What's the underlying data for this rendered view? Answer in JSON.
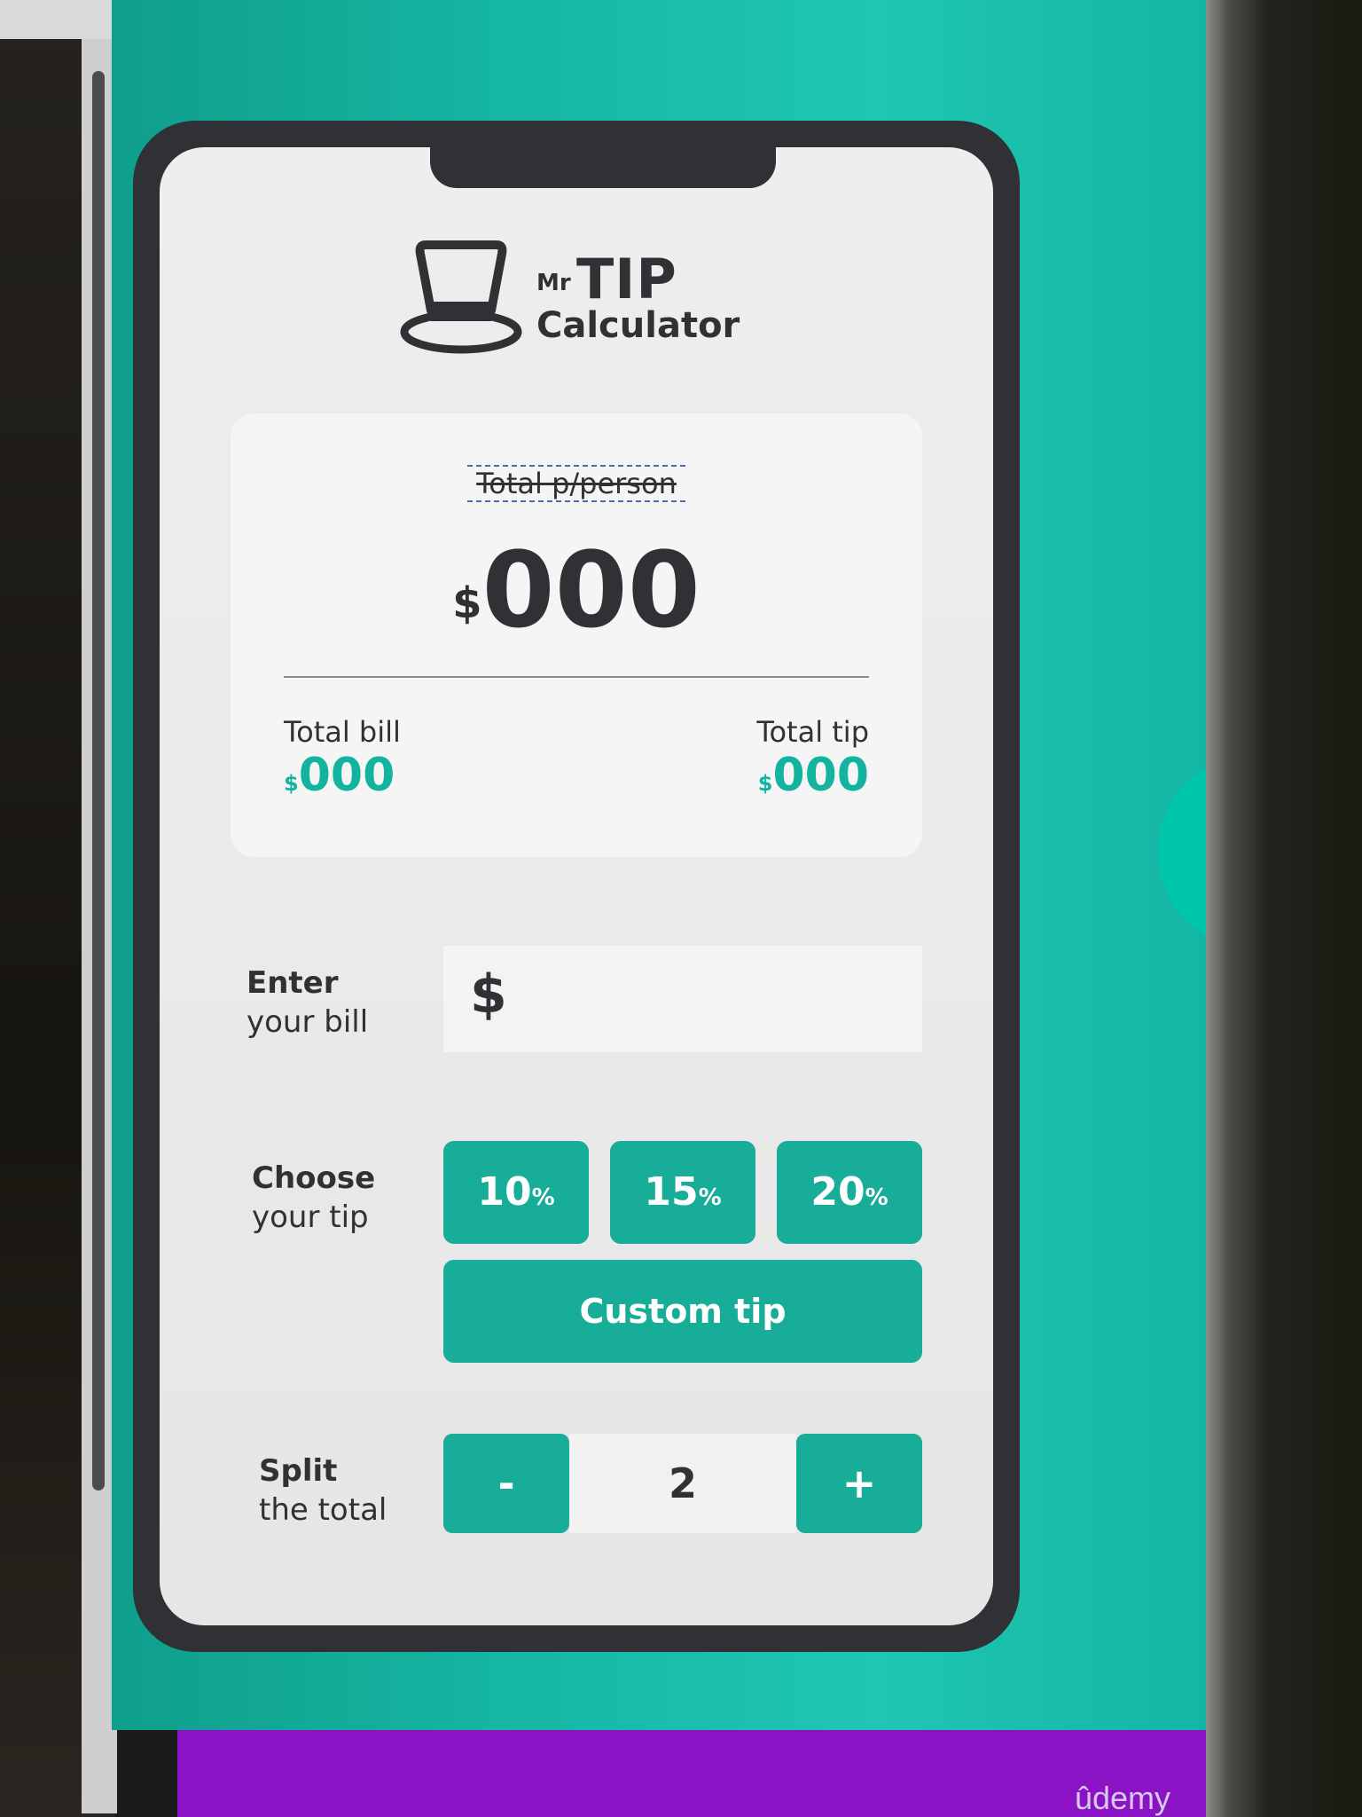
{
  "app": {
    "logo_prefix": "Mr",
    "logo_title": "TIP",
    "logo_subtitle": "Calculator"
  },
  "summary": {
    "per_person_label": "Total p/person",
    "per_person_currency": "$",
    "per_person_value": "000",
    "total_bill_label": "Total bill",
    "total_bill_currency": "$",
    "total_bill_value": "000",
    "total_tip_label": "Total tip",
    "total_tip_currency": "$",
    "total_tip_value": "000"
  },
  "bill": {
    "label_bold": "Enter",
    "label_rest": "your bill",
    "currency": "$"
  },
  "tip": {
    "label_bold": "Choose",
    "label_rest": "your tip",
    "options": [
      {
        "value": "10",
        "unit": "%"
      },
      {
        "value": "15",
        "unit": "%"
      },
      {
        "value": "20",
        "unit": "%"
      }
    ],
    "custom_label": "Custom tip"
  },
  "split": {
    "label_bold": "Split",
    "label_rest": "the total",
    "minus": "-",
    "count": "2",
    "plus": "+"
  },
  "footer": {
    "brand": "ûdemy"
  },
  "colors": {
    "accent": "#17ad98",
    "background": "#15b6a2",
    "phone_frame": "#2f3135",
    "footer": "#8a13c6"
  }
}
